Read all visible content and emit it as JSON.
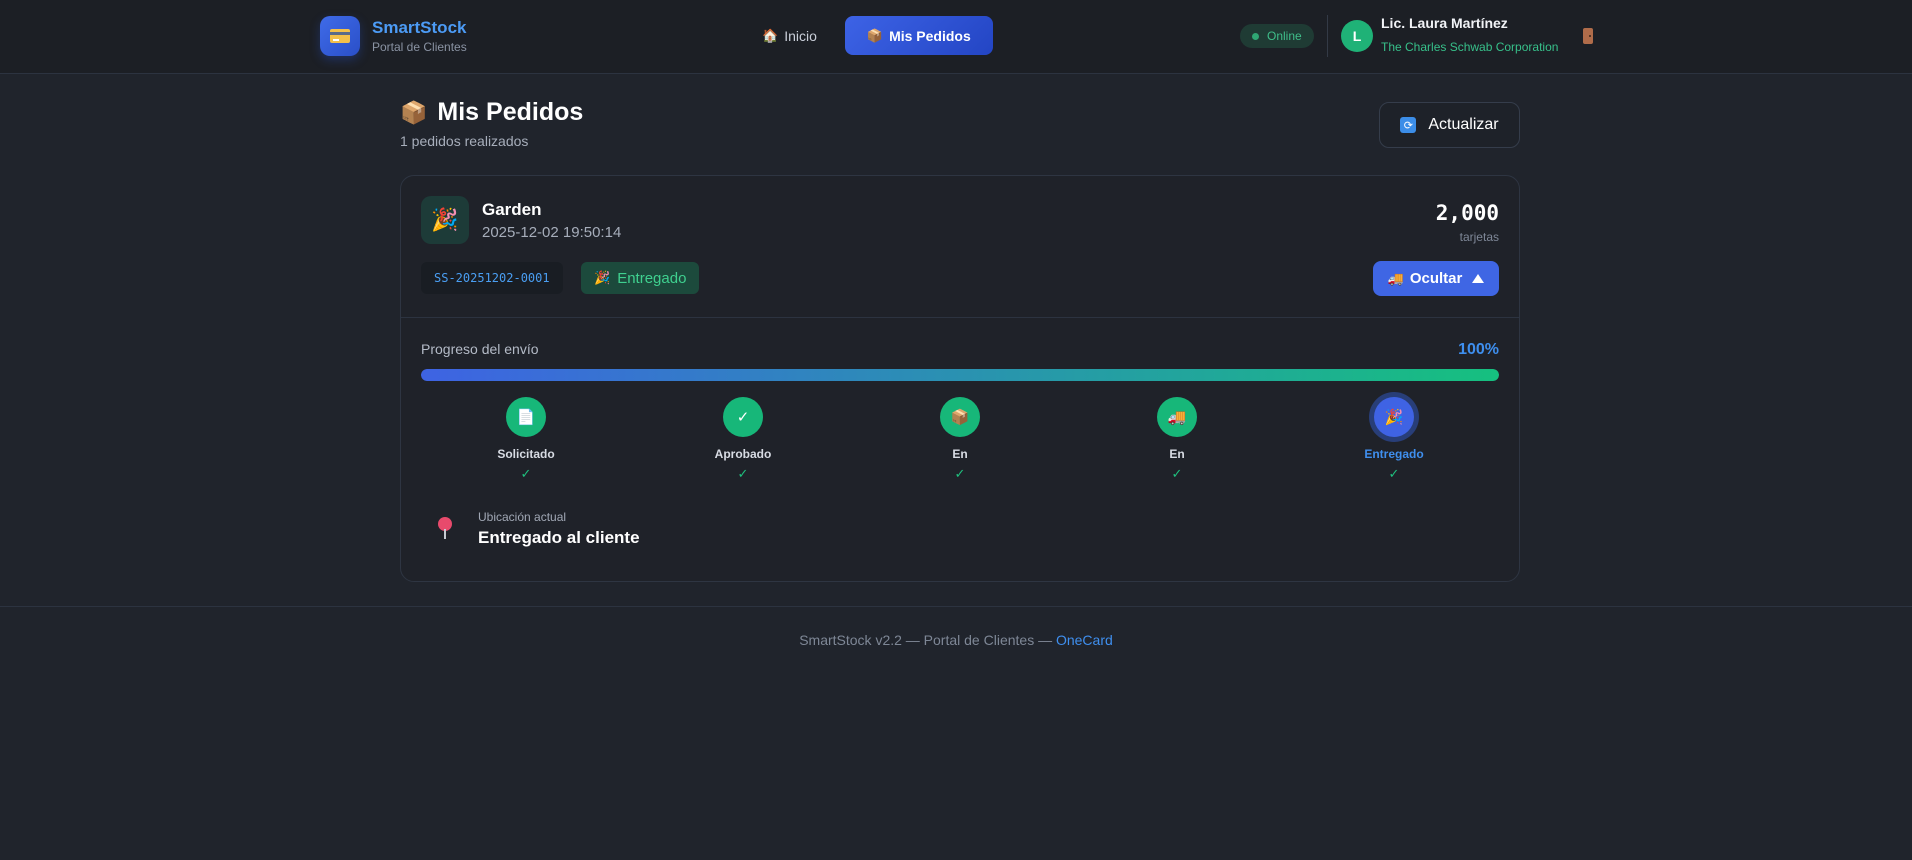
{
  "app": {
    "brand_name": "SmartStock",
    "brand_sub": "Portal de Clientes",
    "brand_icon": "credit-card-icon"
  },
  "nav": {
    "items": [
      {
        "emoji": "🏠",
        "label": "Inicio",
        "active": false
      },
      {
        "emoji": "📦",
        "label": "Mis Pedidos",
        "active": true
      }
    ]
  },
  "status": {
    "label": "Online",
    "color": "#2fa774"
  },
  "user": {
    "initial": "L",
    "name": "Lic. Laura Martínez",
    "company": "The Charles Schwab Corporation",
    "logout_icon": "door-icon"
  },
  "page": {
    "title_emoji": "📦",
    "title": "Mis Pedidos",
    "count_text": "1 pedidos realizados",
    "refresh_icon": "🔄",
    "refresh_label": "Actualizar"
  },
  "orders": [
    {
      "icon": "🎉",
      "name": "Garden",
      "date": "2025-12-02 19:50:14",
      "quantity": "2,000",
      "quantity_unit": "tarjetas",
      "code": "SS-20251202-0001",
      "status_emoji": "🎉",
      "status": "Entregado",
      "toggle_emoji": "🚚",
      "toggle_label": "Ocultar",
      "progress_label": "Progreso del envío",
      "progress_text": "100%",
      "progress_value": 100,
      "steps": [
        {
          "icon": "📄",
          "label": "Solicitado",
          "check": "✓"
        },
        {
          "icon": "✓",
          "label": "Aprobado",
          "check": "✓"
        },
        {
          "icon": "📦",
          "label": "En",
          "check": "✓"
        },
        {
          "icon": "🚚",
          "label": "En",
          "check": "✓"
        },
        {
          "icon": "🎉",
          "label": "Entregado",
          "check": "✓"
        }
      ],
      "location_label": "Ubicación actual",
      "location_value": "Entregado al cliente"
    }
  ],
  "footer": {
    "text": "SmartStock v2.2 — Portal de Clientes — ",
    "link": "OneCard"
  },
  "colors": {
    "accent": "#3f66e4",
    "success": "#17b779",
    "brand_text": "#4c9bf5",
    "background": "#20242c"
  }
}
